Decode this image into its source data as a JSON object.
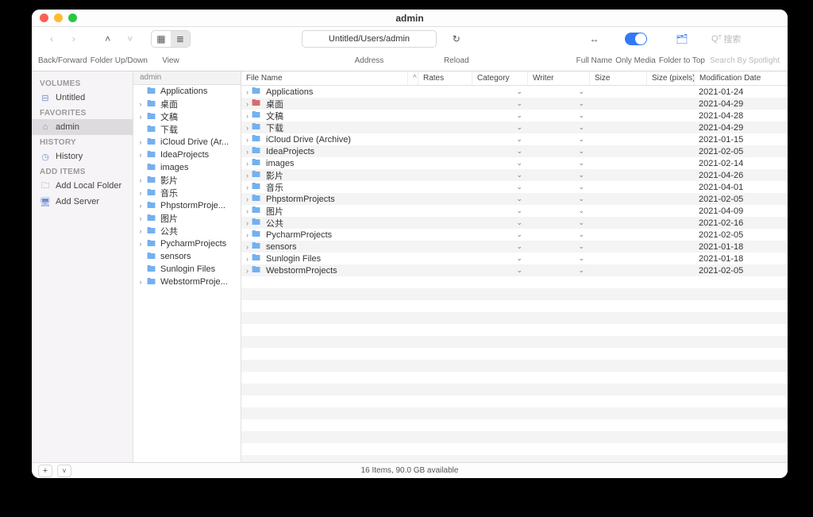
{
  "window": {
    "title": "admin"
  },
  "toolbar": {
    "back_forward": "Back/Forward",
    "folder_updown": "Folder Up/Down",
    "view": "View",
    "address": "Address",
    "address_value": "Untitled/Users/admin",
    "reload": "Reload",
    "full_name": "Full Name",
    "only_media": "Only Media",
    "folder_to_top": "Folder to Top",
    "search": "Search By Spotlight",
    "search_placeholder": "搜索",
    "search_icon_prefix": "Qᵀ"
  },
  "sidebar": {
    "sections": [
      {
        "title": "VOLUMES",
        "items": [
          {
            "icon": "disk",
            "label": "Untitled",
            "selected": false
          }
        ]
      },
      {
        "title": "FAVORITES",
        "items": [
          {
            "icon": "home",
            "label": "admin",
            "selected": true
          }
        ]
      },
      {
        "title": "HISTORY",
        "items": [
          {
            "icon": "clock",
            "label": "History",
            "selected": false
          }
        ]
      },
      {
        "title": "ADD ITEMS",
        "items": [
          {
            "icon": "folder-plus",
            "label": "Add Local Folder",
            "selected": false
          },
          {
            "icon": "server-plus",
            "label": "Add Server",
            "selected": false
          }
        ]
      }
    ]
  },
  "tree": {
    "header": "admin",
    "items": [
      {
        "exp": false,
        "label": "Applications"
      },
      {
        "exp": true,
        "label": "桌面"
      },
      {
        "exp": true,
        "label": "文稿"
      },
      {
        "exp": false,
        "label": "下载"
      },
      {
        "exp": true,
        "label": "iCloud Drive (Ar..."
      },
      {
        "exp": true,
        "label": "IdeaProjects"
      },
      {
        "exp": false,
        "label": "images"
      },
      {
        "exp": true,
        "label": "影片"
      },
      {
        "exp": true,
        "label": "音乐"
      },
      {
        "exp": true,
        "label": "PhpstormProje..."
      },
      {
        "exp": true,
        "label": "图片"
      },
      {
        "exp": true,
        "label": "公共"
      },
      {
        "exp": true,
        "label": "PycharmProjects"
      },
      {
        "exp": false,
        "label": "sensors"
      },
      {
        "exp": false,
        "label": "Sunlogin Files"
      },
      {
        "exp": true,
        "label": "WebstormProje..."
      }
    ]
  },
  "list": {
    "columns": {
      "name": "File Name",
      "rates": "Rates",
      "category": "Category",
      "writer": "Writer",
      "size": "Size",
      "pixels": "Size (pixels)",
      "mod": "Modification Date"
    },
    "rows": [
      {
        "name": "Applications",
        "icon": "folder",
        "mod": "2021-01-24"
      },
      {
        "name": "桌面",
        "icon": "folder-red",
        "mod": "2021-04-29"
      },
      {
        "name": "文稿",
        "icon": "folder",
        "mod": "2021-04-28"
      },
      {
        "name": "下载",
        "icon": "folder",
        "mod": "2021-04-29"
      },
      {
        "name": "iCloud Drive (Archive)",
        "icon": "folder",
        "mod": "2021-01-15"
      },
      {
        "name": "IdeaProjects",
        "icon": "folder",
        "mod": "2021-02-05"
      },
      {
        "name": "images",
        "icon": "folder",
        "mod": "2021-02-14"
      },
      {
        "name": "影片",
        "icon": "folder",
        "mod": "2021-04-26"
      },
      {
        "name": "音乐",
        "icon": "folder",
        "mod": "2021-04-01"
      },
      {
        "name": "PhpstormProjects",
        "icon": "folder",
        "mod": "2021-02-05"
      },
      {
        "name": "图片",
        "icon": "folder",
        "mod": "2021-04-09"
      },
      {
        "name": "公共",
        "icon": "folder",
        "mod": "2021-02-16"
      },
      {
        "name": "PycharmProjects",
        "icon": "folder",
        "mod": "2021-02-05"
      },
      {
        "name": "sensors",
        "icon": "folder",
        "mod": "2021-01-18"
      },
      {
        "name": "Sunlogin Files",
        "icon": "folder",
        "mod": "2021-01-18"
      },
      {
        "name": "WebstormProjects",
        "icon": "folder",
        "mod": "2021-02-05"
      }
    ]
  },
  "status": {
    "text": "16 Items, 90.0 GB available"
  }
}
